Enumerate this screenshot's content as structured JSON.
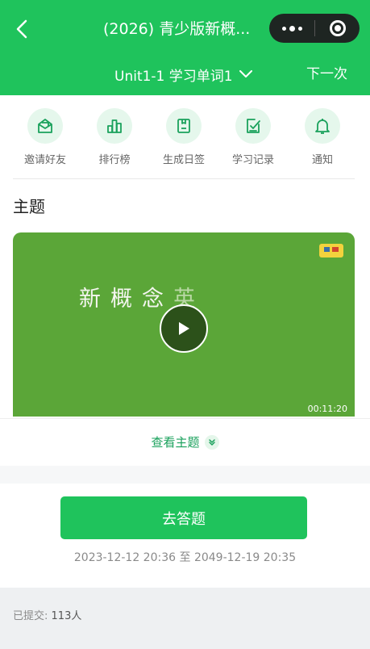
{
  "header": {
    "title": "(2026) 青少版新概...",
    "unit_selector": "Unit1-1 学习单词1",
    "next_label": "下一次"
  },
  "actions": [
    {
      "label": "邀请好友",
      "icon": "envelope-open-icon"
    },
    {
      "label": "排行榜",
      "icon": "ranking-bars-icon"
    },
    {
      "label": "生成日签",
      "icon": "daily-card-icon"
    },
    {
      "label": "学习记录",
      "icon": "record-check-icon"
    },
    {
      "label": "通知",
      "icon": "bell-icon"
    }
  ],
  "topic": {
    "title": "主题",
    "video_text": [
      "新",
      "概",
      "念",
      "英"
    ],
    "duration": "00:11:20",
    "view_label": "查看主题"
  },
  "answer": {
    "button_label": "去答题",
    "start": "2023-12-12 20:36",
    "to": "至",
    "end": "2049-12-19 20:35"
  },
  "stats": {
    "submitted_label": "已提交:",
    "submitted_count": "113人"
  },
  "colors": {
    "primary": "#1fc35c",
    "video_bg": "#5ba638",
    "icon_bg": "#e5f7ec",
    "link": "#1aa15c"
  }
}
